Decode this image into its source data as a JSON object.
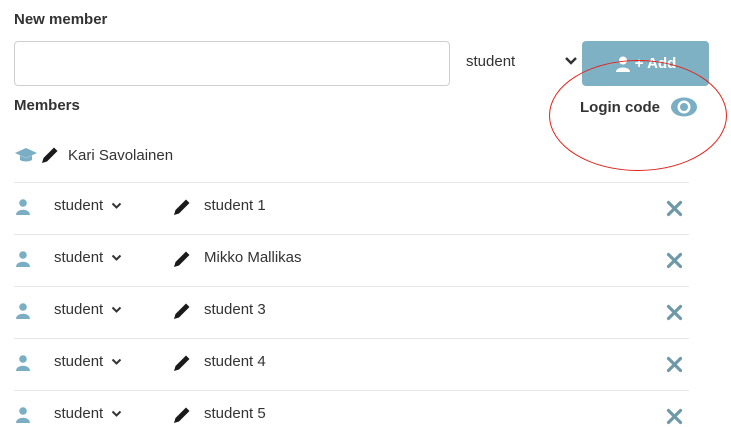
{
  "new_member": {
    "heading": "New member",
    "name_value": "",
    "name_placeholder": "",
    "role_selected": "student",
    "add_label": "+ Add"
  },
  "members": {
    "heading": "Members",
    "login_code_label": "Login code",
    "teacher": {
      "name": "Kari Savolainen"
    },
    "rows": [
      {
        "role": "student",
        "name": "student 1"
      },
      {
        "role": "student",
        "name": "Mikko Mallikas"
      },
      {
        "role": "student",
        "name": "student 3"
      },
      {
        "role": "student",
        "name": "student 4"
      },
      {
        "role": "student",
        "name": "student 5"
      }
    ]
  },
  "colors": {
    "accent": "#7fb1c5",
    "icon_blue": "#7aaec4",
    "remove_x": "#6f98a8",
    "annotation_red": "#e2231a"
  },
  "icons": {
    "person": "user-icon",
    "pencil": "pencil-icon",
    "teacher": "graduation-cap-icon",
    "remove": "close-icon",
    "eye": "eye-icon",
    "chevron": "chevron-down-icon"
  }
}
